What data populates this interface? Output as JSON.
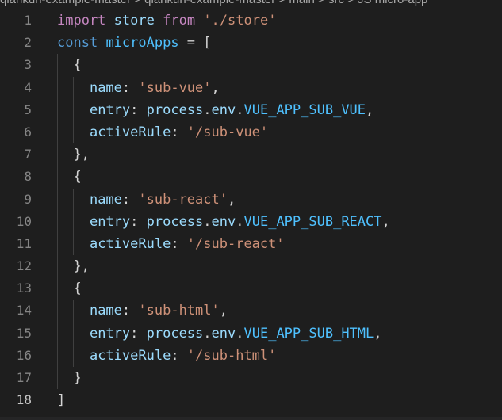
{
  "breadcrumb": "qiankun-example-master > qiankun-example-master > main > src > JS micro-app",
  "editor": {
    "current_line": 18,
    "lines": [
      {
        "number": "1",
        "tokens": [
          [
            "kw-ctrl",
            "import"
          ],
          [
            "punc",
            " "
          ],
          [
            "var",
            "store"
          ],
          [
            "punc",
            " "
          ],
          [
            "kw-ctrl",
            "from"
          ],
          [
            "punc",
            " "
          ],
          [
            "str",
            "'./store'"
          ]
        ]
      },
      {
        "number": "2",
        "tokens": [
          [
            "kw",
            "const"
          ],
          [
            "punc",
            " "
          ],
          [
            "const",
            "microApps"
          ],
          [
            "punc",
            " = ["
          ]
        ]
      },
      {
        "number": "3",
        "tokens": [
          [
            "punc",
            "  {"
          ]
        ]
      },
      {
        "number": "4",
        "tokens": [
          [
            "punc",
            "    "
          ],
          [
            "var",
            "name"
          ],
          [
            "punc",
            ": "
          ],
          [
            "str",
            "'sub-vue'"
          ],
          [
            "punc",
            ","
          ]
        ]
      },
      {
        "number": "5",
        "tokens": [
          [
            "punc",
            "    "
          ],
          [
            "var",
            "entry"
          ],
          [
            "punc",
            ": "
          ],
          [
            "var",
            "process"
          ],
          [
            "punc",
            "."
          ],
          [
            "var",
            "env"
          ],
          [
            "punc",
            "."
          ],
          [
            "const",
            "VUE_APP_SUB_VUE"
          ],
          [
            "punc",
            ","
          ]
        ]
      },
      {
        "number": "6",
        "tokens": [
          [
            "punc",
            "    "
          ],
          [
            "var",
            "activeRule"
          ],
          [
            "punc",
            ": "
          ],
          [
            "str",
            "'/sub-vue'"
          ]
        ]
      },
      {
        "number": "7",
        "tokens": [
          [
            "punc",
            "  },"
          ]
        ]
      },
      {
        "number": "8",
        "tokens": [
          [
            "punc",
            "  {"
          ]
        ]
      },
      {
        "number": "9",
        "tokens": [
          [
            "punc",
            "    "
          ],
          [
            "var",
            "name"
          ],
          [
            "punc",
            ": "
          ],
          [
            "str",
            "'sub-react'"
          ],
          [
            "punc",
            ","
          ]
        ]
      },
      {
        "number": "10",
        "tokens": [
          [
            "punc",
            "    "
          ],
          [
            "var",
            "entry"
          ],
          [
            "punc",
            ": "
          ],
          [
            "var",
            "process"
          ],
          [
            "punc",
            "."
          ],
          [
            "var",
            "env"
          ],
          [
            "punc",
            "."
          ],
          [
            "const",
            "VUE_APP_SUB_REACT"
          ],
          [
            "punc",
            ","
          ]
        ]
      },
      {
        "number": "11",
        "tokens": [
          [
            "punc",
            "    "
          ],
          [
            "var",
            "activeRule"
          ],
          [
            "punc",
            ": "
          ],
          [
            "str",
            "'/sub-react'"
          ]
        ]
      },
      {
        "number": "12",
        "tokens": [
          [
            "punc",
            "  },"
          ]
        ]
      },
      {
        "number": "13",
        "tokens": [
          [
            "punc",
            "  {"
          ]
        ]
      },
      {
        "number": "14",
        "tokens": [
          [
            "punc",
            "    "
          ],
          [
            "var",
            "name"
          ],
          [
            "punc",
            ": "
          ],
          [
            "str",
            "'sub-html'"
          ],
          [
            "punc",
            ","
          ]
        ]
      },
      {
        "number": "15",
        "tokens": [
          [
            "punc",
            "    "
          ],
          [
            "var",
            "entry"
          ],
          [
            "punc",
            ": "
          ],
          [
            "var",
            "process"
          ],
          [
            "punc",
            "."
          ],
          [
            "var",
            "env"
          ],
          [
            "punc",
            "."
          ],
          [
            "const",
            "VUE_APP_SUB_HTML"
          ],
          [
            "punc",
            ","
          ]
        ]
      },
      {
        "number": "16",
        "tokens": [
          [
            "punc",
            "    "
          ],
          [
            "var",
            "activeRule"
          ],
          [
            "punc",
            ": "
          ],
          [
            "str",
            "'/sub-html'"
          ]
        ]
      },
      {
        "number": "17",
        "tokens": [
          [
            "punc",
            "  }"
          ]
        ]
      },
      {
        "number": "18",
        "tokens": [
          [
            "punc",
            "]"
          ]
        ]
      }
    ]
  }
}
